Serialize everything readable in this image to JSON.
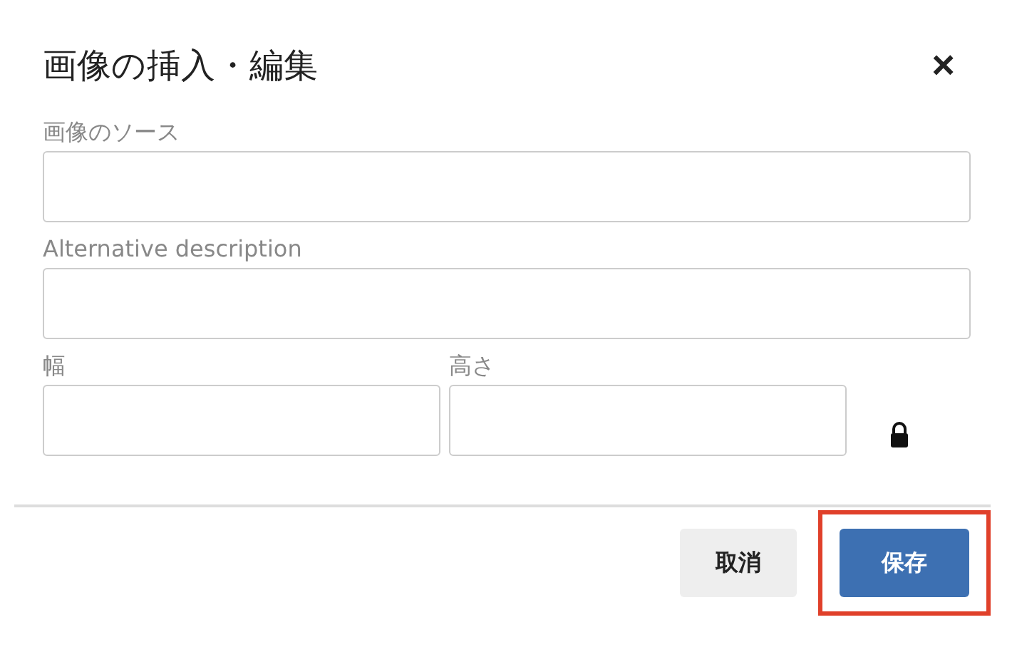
{
  "dialog": {
    "title": "画像の挿入・編集",
    "close": "×"
  },
  "fields": [
    {
      "label": "画像のソース"
    },
    {
      "label": "Alternative description"
    }
  ],
  "size_fields": [
    {
      "label": "幅"
    },
    {
      "label": "高さ"
    }
  ],
  "aspect_lock": {
    "locked": true
  },
  "buttons": [
    {
      "label": "取消",
      "kind": "secondary",
      "highlighted": false
    },
    {
      "label": "保存",
      "kind": "primary",
      "highlighted": true
    }
  ]
}
